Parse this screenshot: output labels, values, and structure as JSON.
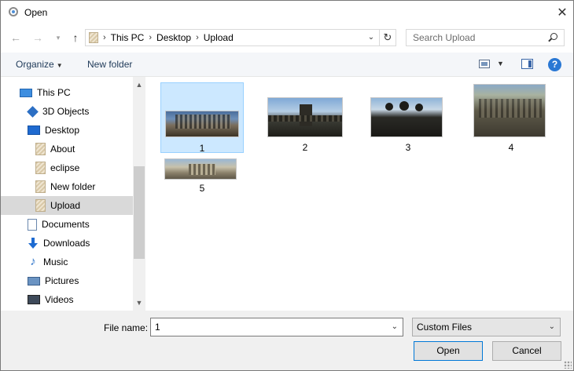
{
  "window": {
    "title": "Open"
  },
  "navigation": {
    "back_icon": "arrow-left-icon",
    "forward_icon": "arrow-right-icon",
    "recent_icon": "chevron-down-icon",
    "up_icon": "arrow-up-icon",
    "breadcrumbs": [
      "This PC",
      "Desktop",
      "Upload"
    ],
    "search_placeholder": "Search Upload"
  },
  "toolbar": {
    "organize_label": "Organize",
    "new_folder_label": "New folder"
  },
  "sidebar": {
    "items": [
      {
        "label": "This PC",
        "icon": "computer-icon",
        "selected": false
      },
      {
        "label": "3D Objects",
        "icon": "cube-icon",
        "selected": false
      },
      {
        "label": "Desktop",
        "icon": "desktop-icon",
        "selected": false
      },
      {
        "label": "About",
        "icon": "folder-icon",
        "selected": false
      },
      {
        "label": "eclipse",
        "icon": "folder-icon",
        "selected": false
      },
      {
        "label": "New folder",
        "icon": "folder-icon",
        "selected": false
      },
      {
        "label": "Upload",
        "icon": "folder-icon",
        "selected": true
      },
      {
        "label": "Documents",
        "icon": "document-icon",
        "selected": false
      },
      {
        "label": "Downloads",
        "icon": "download-icon",
        "selected": false
      },
      {
        "label": "Music",
        "icon": "music-icon",
        "selected": false
      },
      {
        "label": "Pictures",
        "icon": "pictures-icon",
        "selected": false
      },
      {
        "label": "Videos",
        "icon": "video-icon",
        "selected": false
      }
    ]
  },
  "files": [
    {
      "name": "1",
      "selected": true
    },
    {
      "name": "2",
      "selected": false
    },
    {
      "name": "3",
      "selected": false
    },
    {
      "name": "4",
      "selected": false
    },
    {
      "name": "5",
      "selected": false
    }
  ],
  "footer": {
    "file_name_label": "File name:",
    "file_name_value": "1",
    "file_type_value": "Custom Files",
    "open_label": "Open",
    "cancel_label": "Cancel"
  },
  "colors": {
    "selection_bg": "#cce8ff",
    "selection_border": "#99d1ff",
    "accent": "#0078d7"
  }
}
